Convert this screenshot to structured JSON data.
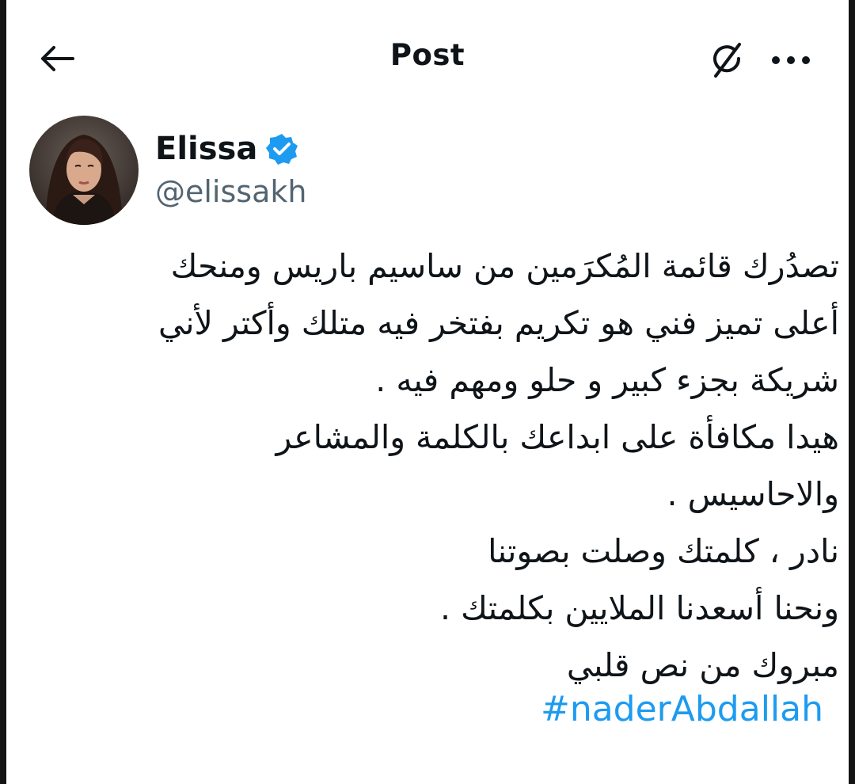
{
  "header": {
    "title": "Post",
    "back_icon": "arrow-left-icon",
    "grok_icon": "grok-icon",
    "more_icon": "more-dots-icon"
  },
  "author": {
    "display_name": "Elissa",
    "handle": "@elissakh",
    "verified_icon": "verified-badge-icon",
    "verified_color": "#1d9bf0"
  },
  "post": {
    "lines": [
      "تصدُرك قائمة المُكرَمين من ساسيم باريس ومنحك",
      "أعلى تميز فني هو تكريم بفتخر فيه متلك وأكتر لأني",
      "شريكة بجزء كبير و حلو ومهم فيه .",
      "هيدا مكافأة على ابداعك بالكلمة والمشاعر",
      "والاحاسيس .",
      "نادر ، كلمتك وصلت بصوتنا",
      "ونحنا أسعدنا الملايين بكلمتك .",
      "مبروك من نص قلبي"
    ],
    "hashtag": "#naderAbdallah",
    "hashtag_color": "#1d9bf0"
  }
}
